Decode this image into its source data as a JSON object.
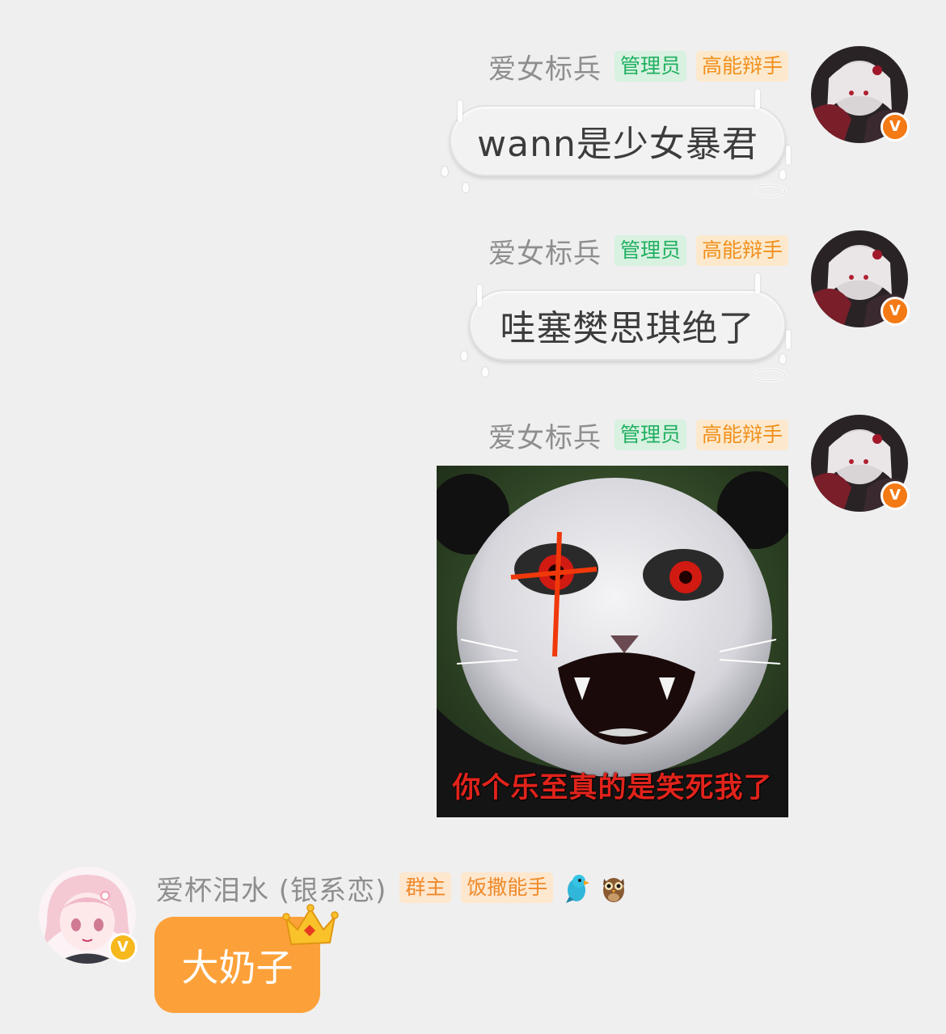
{
  "messages": [
    {
      "sender": "爱女标兵",
      "tags": [
        "管理员",
        "高能辩手"
      ],
      "text": "wann是少女暴君",
      "badge": "V"
    },
    {
      "sender": "爱女标兵",
      "tags": [
        "管理员",
        "高能辩手"
      ],
      "text": "哇塞樊思琪绝了",
      "badge": "V"
    },
    {
      "sender": "爱女标兵",
      "tags": [
        "管理员",
        "高能辩手"
      ],
      "meme_caption": "你个乐至真的是笑死我了",
      "badge": "V"
    },
    {
      "sender": "爱杯泪水 (银系恋)",
      "tags": [
        "群主",
        "饭撒能手"
      ],
      "text": "大奶子",
      "badge": "V",
      "emoji_badges": [
        "parrot-icon",
        "owl-icon"
      ]
    }
  ],
  "colors": {
    "background": "#efefef",
    "admin_tag": "#20b060",
    "talent_tag": "#f0901c",
    "owner_bubble": "#fca13a",
    "verified_badge": "#f47a16",
    "owner_badge": "#f6b81c"
  }
}
